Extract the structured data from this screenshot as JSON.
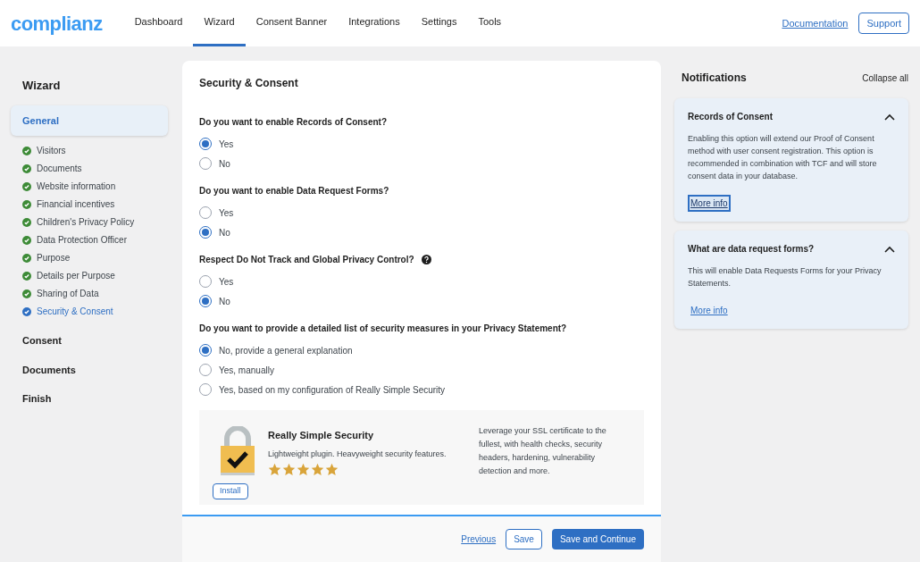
{
  "header": {
    "logo": "complianz",
    "nav": [
      {
        "label": "Dashboard",
        "selected": false
      },
      {
        "label": "Wizard",
        "selected": true
      },
      {
        "label": "Consent Banner",
        "selected": false
      },
      {
        "label": "Integrations",
        "selected": false
      },
      {
        "label": "Settings",
        "selected": false
      },
      {
        "label": "Tools",
        "selected": false
      }
    ],
    "documentation": "Documentation",
    "support": "Support"
  },
  "sidebar": {
    "title": "Wizard",
    "sections": [
      {
        "label": "General",
        "selected": true,
        "steps": [
          {
            "label": "Visitors",
            "selected": false
          },
          {
            "label": "Documents",
            "selected": false
          },
          {
            "label": "Website information",
            "selected": false
          },
          {
            "label": "Financial incentives",
            "selected": false
          },
          {
            "label": "Children's Privacy Policy",
            "selected": false
          },
          {
            "label": "Data Protection Officer",
            "selected": false
          },
          {
            "label": "Purpose",
            "selected": false
          },
          {
            "label": "Details per Purpose",
            "selected": false
          },
          {
            "label": "Sharing of Data",
            "selected": false
          },
          {
            "label": "Security & Consent",
            "selected": true
          }
        ]
      },
      {
        "label": "Consent",
        "selected": false
      },
      {
        "label": "Documents",
        "selected": false
      },
      {
        "label": "Finish",
        "selected": false
      }
    ]
  },
  "main": {
    "title": "Security & Consent",
    "questions": [
      {
        "label": "Do you want to enable Records of Consent?",
        "help": false,
        "options": [
          {
            "label": "Yes",
            "selected": true
          },
          {
            "label": "No",
            "selected": false
          }
        ]
      },
      {
        "label": "Do you want to enable Data Request Forms?",
        "help": false,
        "options": [
          {
            "label": "Yes",
            "selected": false
          },
          {
            "label": "No",
            "selected": true
          }
        ]
      },
      {
        "label": "Respect Do Not Track and Global Privacy Control?",
        "help": true,
        "options": [
          {
            "label": "Yes",
            "selected": false
          },
          {
            "label": "No",
            "selected": true
          }
        ]
      },
      {
        "label": "Do you want to provide a detailed list of security measures in your Privacy Statement?",
        "help": false,
        "options": [
          {
            "label": "No, provide a general explanation",
            "selected": true
          },
          {
            "label": "Yes, manually",
            "selected": false
          },
          {
            "label": "Yes, based on my configuration of Really Simple Security",
            "selected": false
          }
        ]
      }
    ],
    "plugin": {
      "name": "Really Simple Security",
      "tagline": "Lightweight plugin. Heavyweight security features.",
      "stars": 5,
      "description": "Leverage your SSL certificate to the fullest, with health checks, security headers, hardening, vulnerability detection and more.",
      "install": "Install"
    },
    "footer": {
      "previous": "Previous",
      "save": "Save",
      "save_continue": "Save and Continue"
    }
  },
  "notifications": {
    "title": "Notifications",
    "collapse_all": "Collapse all",
    "items": [
      {
        "title": "Records of Consent",
        "expanded": true,
        "text": "Enabling this option will extend our Proof of Consent method with user consent registration. This option is recommended in combination with TCF and will store consent data in your database.",
        "link": "More info",
        "focused": true
      },
      {
        "title": "What are data request forms?",
        "expanded": true,
        "text": "This will enable Data Requests Forms for your Privacy Statements.",
        "link": "More info",
        "focused": false
      }
    ]
  }
}
